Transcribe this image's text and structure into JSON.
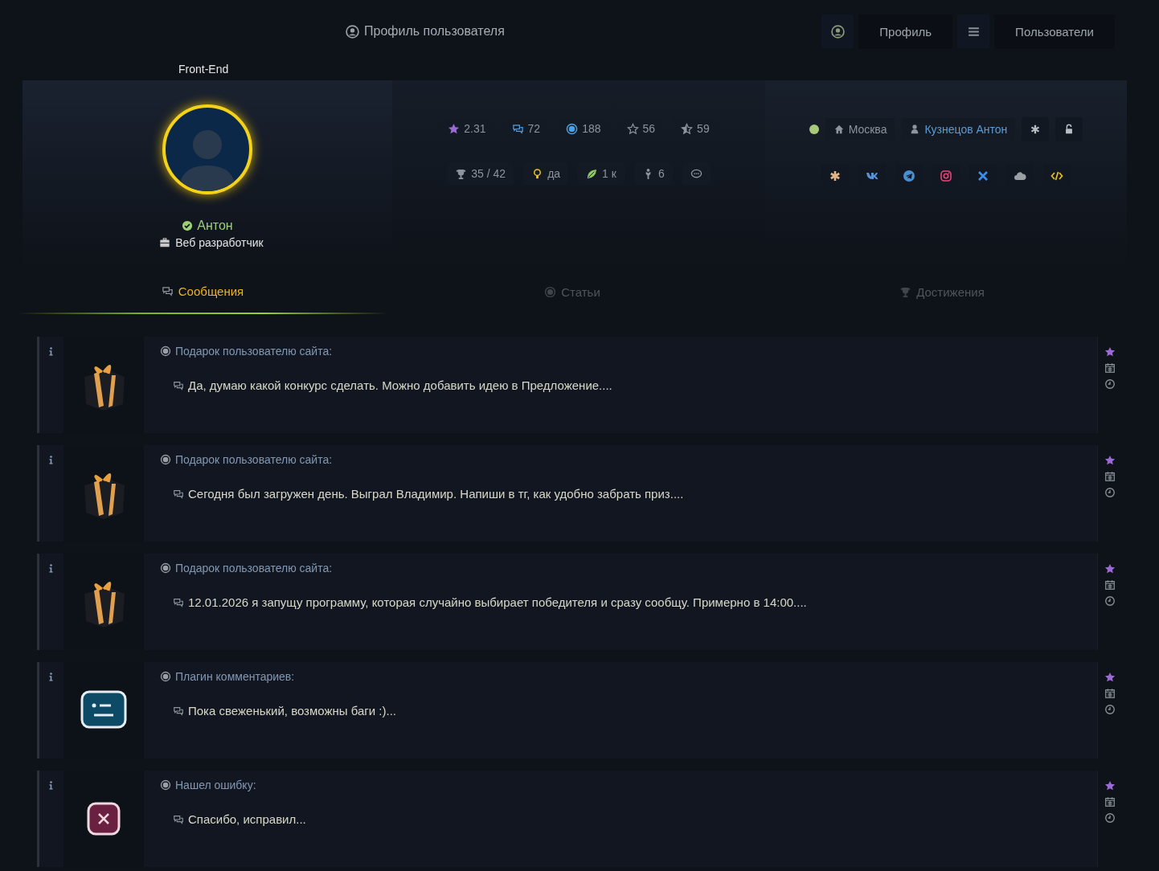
{
  "header": {
    "title": "Профиль пользователя",
    "nav": [
      {
        "kind": "user-icon"
      },
      {
        "kind": "link",
        "label": "Профиль"
      },
      {
        "kind": "menu-icon"
      },
      {
        "kind": "link",
        "label": "Пользователи"
      }
    ]
  },
  "profile": {
    "badge": "Front-End",
    "name": "Антон",
    "verified": true,
    "position": "Веб разработчик"
  },
  "stats": [
    [
      {
        "kind": "rating",
        "value": "2.31"
      },
      {
        "kind": "comments",
        "value": "72"
      },
      {
        "kind": "posts",
        "value": "188"
      },
      {
        "kind": "favorites",
        "value": "56"
      },
      {
        "kind": "stars",
        "value": "59"
      }
    ],
    [
      {
        "kind": "trophy",
        "value": "35 / 42"
      },
      {
        "kind": "idea",
        "value": "да"
      },
      {
        "kind": "leaf",
        "value": "1 к"
      },
      {
        "kind": "figure",
        "value": "6"
      },
      {
        "kind": "chat"
      }
    ]
  ],
  "info": {
    "online": true,
    "city": "Москва",
    "full_name": "Кузнецов Антон",
    "actions": [
      {
        "kind": "asterisk"
      },
      {
        "kind": "unlock"
      }
    ]
  },
  "socials": [
    {
      "kind": "asterisk"
    },
    {
      "kind": "vk"
    },
    {
      "kind": "telegram"
    },
    {
      "kind": "instagram"
    },
    {
      "kind": "x"
    },
    {
      "kind": "cloud"
    },
    {
      "kind": "code"
    }
  ],
  "tabs": [
    {
      "kind": "messages",
      "label": "Сообщения",
      "selected": true
    },
    {
      "kind": "articles",
      "label": "Статьи",
      "selected": false
    },
    {
      "kind": "achievements",
      "label": "Достижения",
      "selected": false
    }
  ],
  "messages": [
    {
      "kind": "gift",
      "title": "Подарок пользователю сайта:",
      "text": "Да, думаю какой конкурс сделать. Можно добавить идею в Предложение...."
    },
    {
      "kind": "gift",
      "title": "Подарок пользователю сайта:",
      "text": "Сегодня был загружен день. Выграл Владимир. Напиши в тг, как удобно забрать приз...."
    },
    {
      "kind": "gift",
      "title": "Подарок пользователю сайта:",
      "text": "12.01.2026 я запущу программу, которая случайно выбирает победителя и сразу сообщу. Примерно в 14:00...."
    },
    {
      "kind": "plugin",
      "title": "Плагин комментариев:",
      "text": "Пока свеженький, возможны баги :)..."
    },
    {
      "kind": "error",
      "title": "Нашел ошибку:",
      "text": "Спасибо, исправил..."
    }
  ]
}
